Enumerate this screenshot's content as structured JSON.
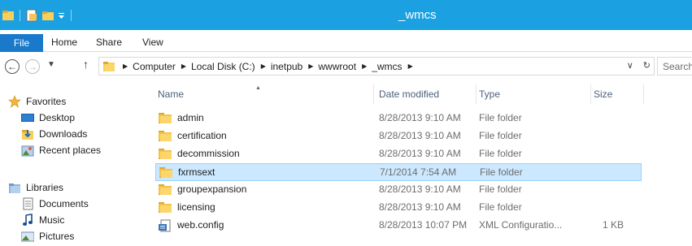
{
  "window": {
    "title": "_wmcs"
  },
  "ribbon": {
    "tabs": [
      "File",
      "Home",
      "Share",
      "View"
    ]
  },
  "address": {
    "crumbs": [
      "Computer",
      "Local Disk (C:)",
      "inetpub",
      "wwwroot",
      "_wmcs"
    ],
    "search_placeholder": "Search"
  },
  "nav": {
    "favorites_label": "Favorites",
    "favorites": [
      "Desktop",
      "Downloads",
      "Recent places"
    ],
    "libraries_label": "Libraries",
    "libraries": [
      "Documents",
      "Music",
      "Pictures"
    ]
  },
  "columns": {
    "name": "Name",
    "date": "Date modified",
    "type": "Type",
    "size": "Size"
  },
  "files": [
    {
      "name": "admin",
      "date": "8/28/2013 9:10 AM",
      "type": "File folder",
      "size": "",
      "icon": "folder-icon",
      "selected": false
    },
    {
      "name": "certification",
      "date": "8/28/2013 9:10 AM",
      "type": "File folder",
      "size": "",
      "icon": "folder-icon",
      "selected": false
    },
    {
      "name": "decommission",
      "date": "8/28/2013 9:10 AM",
      "type": "File folder",
      "size": "",
      "icon": "folder-icon",
      "selected": false
    },
    {
      "name": "fxrmsext",
      "date": "7/1/2014 7:54 AM",
      "type": "File folder",
      "size": "",
      "icon": "folder-icon",
      "selected": true
    },
    {
      "name": "groupexpansion",
      "date": "8/28/2013 9:10 AM",
      "type": "File folder",
      "size": "",
      "icon": "folder-icon",
      "selected": false
    },
    {
      "name": "licensing",
      "date": "8/28/2013 9:10 AM",
      "type": "File folder",
      "size": "",
      "icon": "folder-icon",
      "selected": false
    },
    {
      "name": "web.config",
      "date": "8/28/2013 10:07 PM",
      "type": "XML Configuratio...",
      "size": "1 KB",
      "icon": "config-file-icon",
      "selected": false
    }
  ],
  "colors": {
    "titlebar": "#1ba1e2",
    "file_tab": "#1979ca",
    "selection": "#cce8ff",
    "selection_border": "#99d1ff"
  }
}
